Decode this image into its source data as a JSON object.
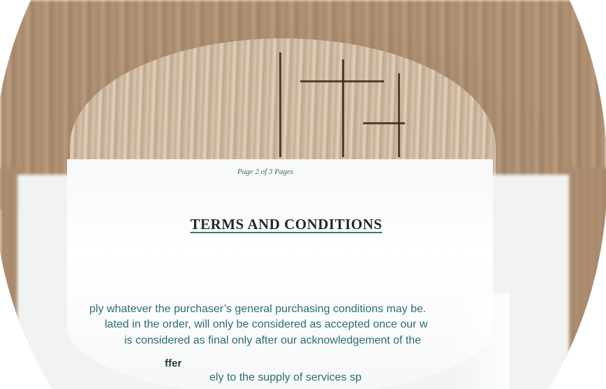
{
  "document": {
    "page_number": "Page 2 of 3 Pages",
    "title": "TERMS AND CONDITIONS",
    "lines": [
      "ply whatever the purchaser’s general purchasing conditions may be.",
      "lated in the order, will only be considered as accepted once our w",
      "is considered as final only after our acknowledgement of the",
      "ffer",
      "ely to the supply of services sp"
    ]
  },
  "colors": {
    "text_teal": "#2a6f73",
    "title_dark": "#1f2a2a",
    "wood": "#a88a6c"
  }
}
